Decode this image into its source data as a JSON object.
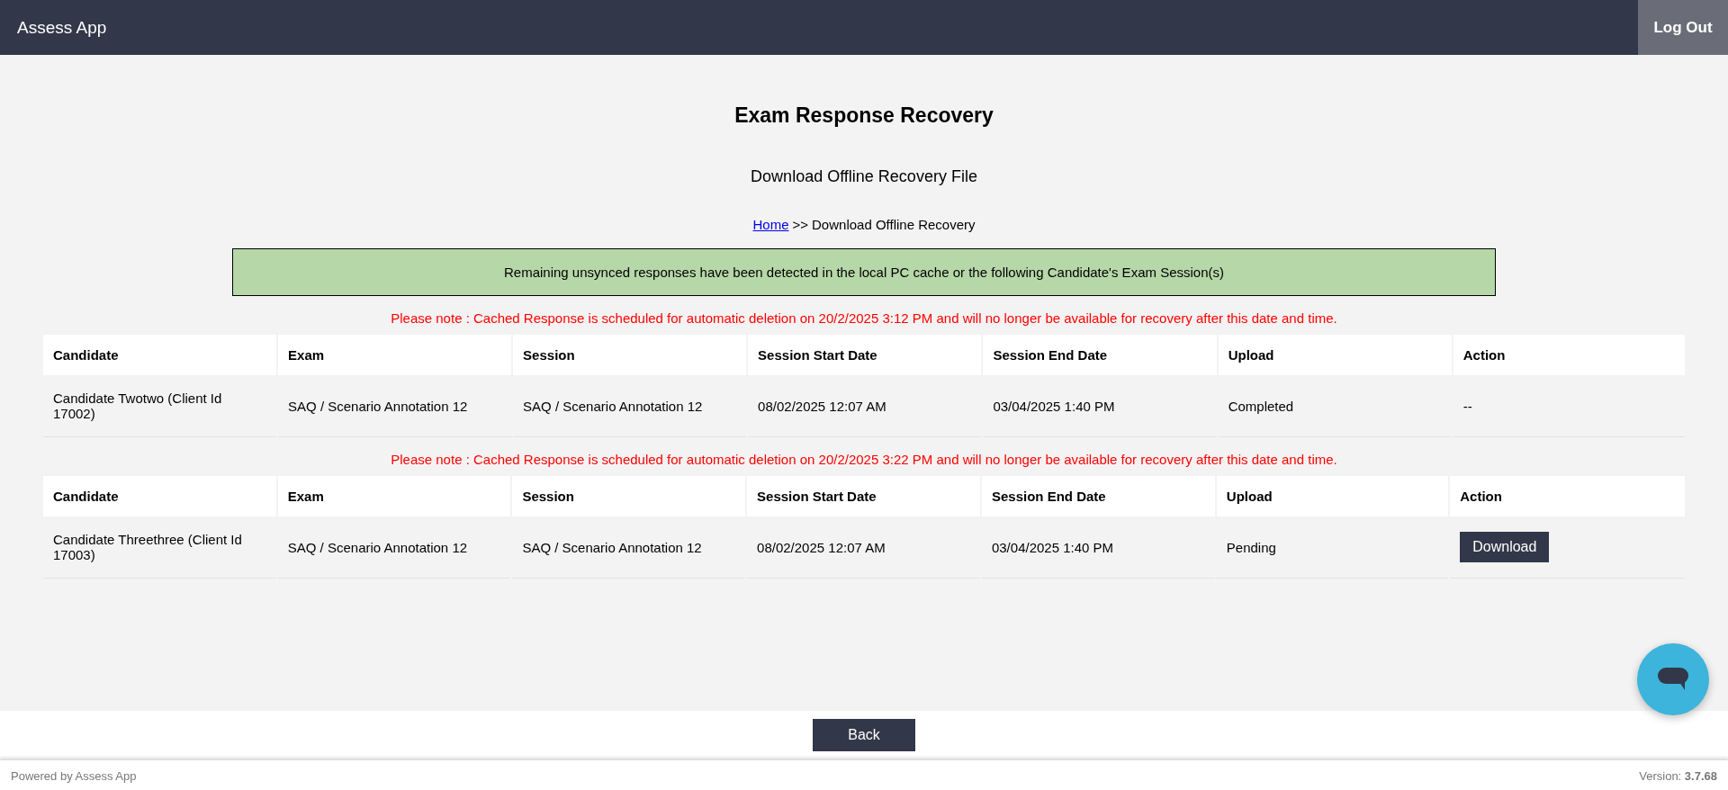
{
  "header": {
    "app_name": "Assess App",
    "logout": "Log Out"
  },
  "page": {
    "title": "Exam Response Recovery",
    "subtitle": "Download Offline Recovery File",
    "breadcrumb": {
      "link": "Home",
      "separator": ">>",
      "current": "Download Offline Recovery"
    },
    "banner": "Remaining unsynced responses have been detected in the local PC cache or the following Candidate's Exam Session(s)"
  },
  "sessions": [
    {
      "note": "Please note : Cached Response is scheduled for automatic deletion on 20/2/2025 3:12 PM and will no longer be available for recovery after this date and time.",
      "columns": [
        "Candidate",
        "Exam",
        "Session",
        "Session Start Date",
        "Session End Date",
        "Upload",
        "Action"
      ],
      "rows": [
        {
          "cells": [
            "Candidate Twotwo (Client Id 17002)",
            "SAQ / Scenario Annotation 12",
            "SAQ / Scenario Annotation 12",
            "08/02/2025 12:07 AM",
            "03/04/2025 1:40 PM",
            "Completed"
          ],
          "action": {
            "kind": "text",
            "label": "--"
          }
        }
      ]
    },
    {
      "note": "Please note : Cached Response is scheduled for automatic deletion on 20/2/2025 3:22 PM and will no longer be available for recovery after this date and time.",
      "columns": [
        "Candidate",
        "Exam",
        "Session",
        "Session Start Date",
        "Session End Date",
        "Upload",
        "Action"
      ],
      "rows": [
        {
          "cells": [
            "Candidate Threethree (Client Id 17003)",
            "SAQ / Scenario Annotation 12",
            "SAQ / Scenario Annotation 12",
            "08/02/2025 12:07 AM",
            "03/04/2025 1:40 PM",
            "Pending"
          ],
          "action": {
            "kind": "button",
            "label": "Download"
          }
        }
      ]
    }
  ],
  "back_button": "Back",
  "footer": {
    "powered_by": "Powered by Assess App",
    "version": "Version: **3.7.68**"
  }
}
